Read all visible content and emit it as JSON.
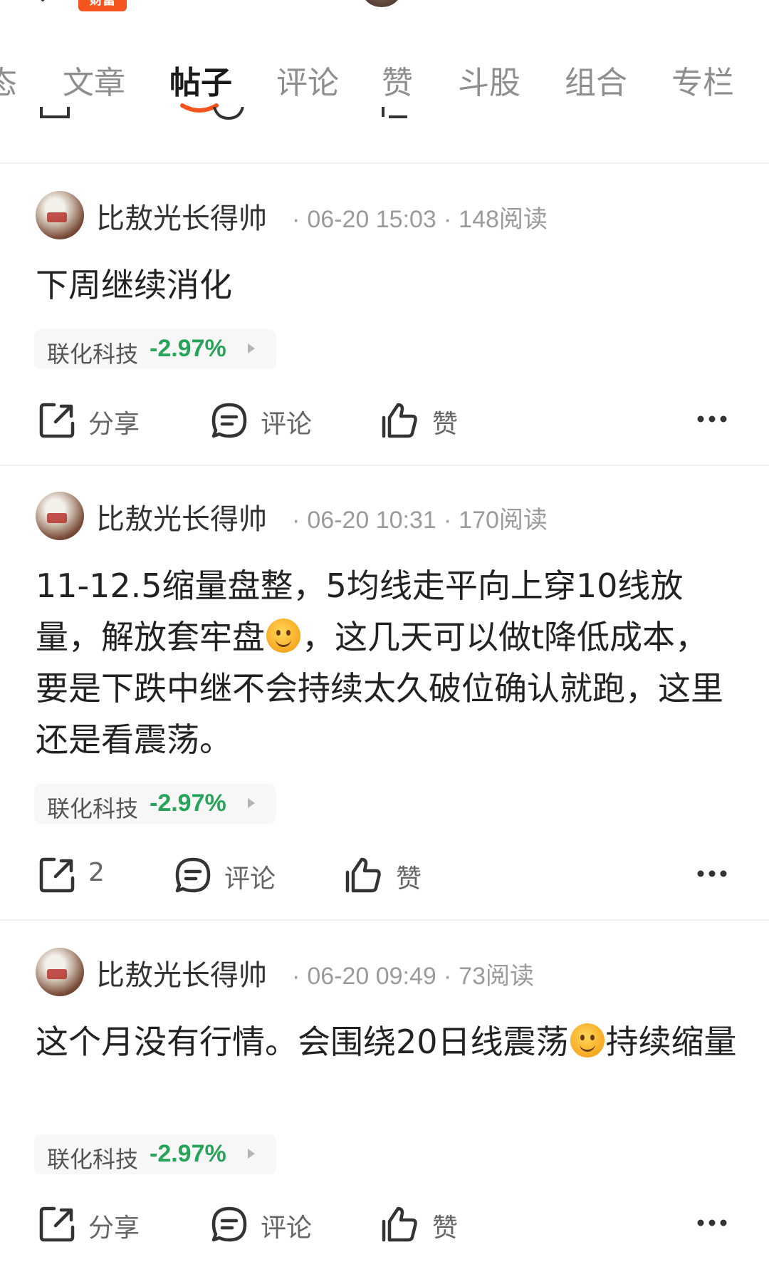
{
  "topbar": {
    "badge_text": "财富",
    "back_icon": "chevron-left-icon",
    "search_icon": "search-icon"
  },
  "tabs": [
    {
      "label": "态",
      "active": false
    },
    {
      "label": "文章",
      "active": false
    },
    {
      "label": "帖子",
      "active": true
    },
    {
      "label": "评论",
      "active": false
    },
    {
      "label": "赞",
      "active": false
    },
    {
      "label": "斗股",
      "active": false
    },
    {
      "label": "组合",
      "active": false
    },
    {
      "label": "专栏",
      "active": false
    }
  ],
  "posts": [
    {
      "author": "比敖光长得帅",
      "date": "06-20 15:03",
      "reads": "148阅读",
      "body": "下周继续消化",
      "stock": {
        "name": "联化科技",
        "change": "-2.97%"
      },
      "actions": {
        "share": "分享",
        "comment": "评论",
        "like": "赞"
      }
    },
    {
      "author": "比敖光长得帅",
      "date": "06-20 10:31",
      "reads": "170阅读",
      "body_parts": [
        "11-12.5缩量盘整，5均线走平向上穿10线放量，解放套牢盘",
        "，这几天可以做t降低成本，要是下跌中继不会持续太久破位确认就跑，这里还是看震荡。"
      ],
      "stock": {
        "name": "联化科技",
        "change": "-2.97%"
      },
      "actions": {
        "share": "2",
        "comment": "评论",
        "like": "赞"
      }
    },
    {
      "author": "比敖光长得帅",
      "date": "06-20 09:49",
      "reads": "73阅读",
      "body_parts": [
        "这个月没有行情。会围绕20日线震荡",
        "持续缩量"
      ],
      "stock": {
        "name": "联化科技",
        "change": "-2.97%"
      },
      "actions": {
        "share": "分享",
        "comment": "评论",
        "like": "赞"
      }
    }
  ],
  "colors": {
    "accent": "#f5541f",
    "stock_down": "#27a35a",
    "muted_text": "#9b9b9b",
    "divider": "#efefef"
  }
}
